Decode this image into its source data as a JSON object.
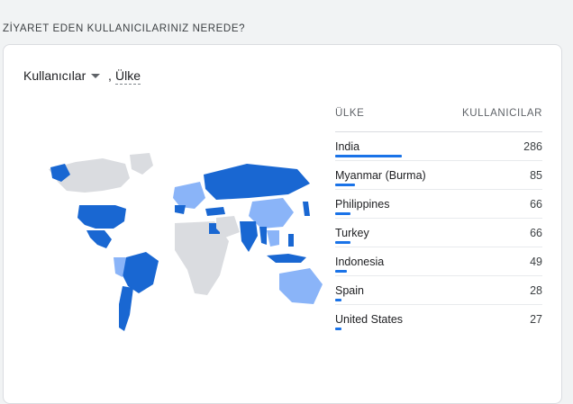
{
  "section_title": "ZİYARET EDEN KULLANICILARINIZ NEREDE?",
  "controls": {
    "metric_label": "Kullanıcılar",
    "separator": ",",
    "dimension_label": "Ülke"
  },
  "table": {
    "col_country": "ÜLKE",
    "col_users": "KULLANICILAR",
    "rows": [
      {
        "country": "India",
        "users": "286",
        "share": 1.0
      },
      {
        "country": "Myanmar (Burma)",
        "users": "85",
        "share": 0.297
      },
      {
        "country": "Philippines",
        "users": "66",
        "share": 0.231
      },
      {
        "country": "Turkey",
        "users": "66",
        "share": 0.231
      },
      {
        "country": "Indonesia",
        "users": "49",
        "share": 0.171
      },
      {
        "country": "Spain",
        "users": "28",
        "share": 0.098
      },
      {
        "country": "United States",
        "users": "27",
        "share": 0.094
      }
    ]
  },
  "colors": {
    "dark": "#1967d2",
    "light": "#8ab4f8",
    "none": "#dadce0",
    "bar": "#1a73e8"
  }
}
